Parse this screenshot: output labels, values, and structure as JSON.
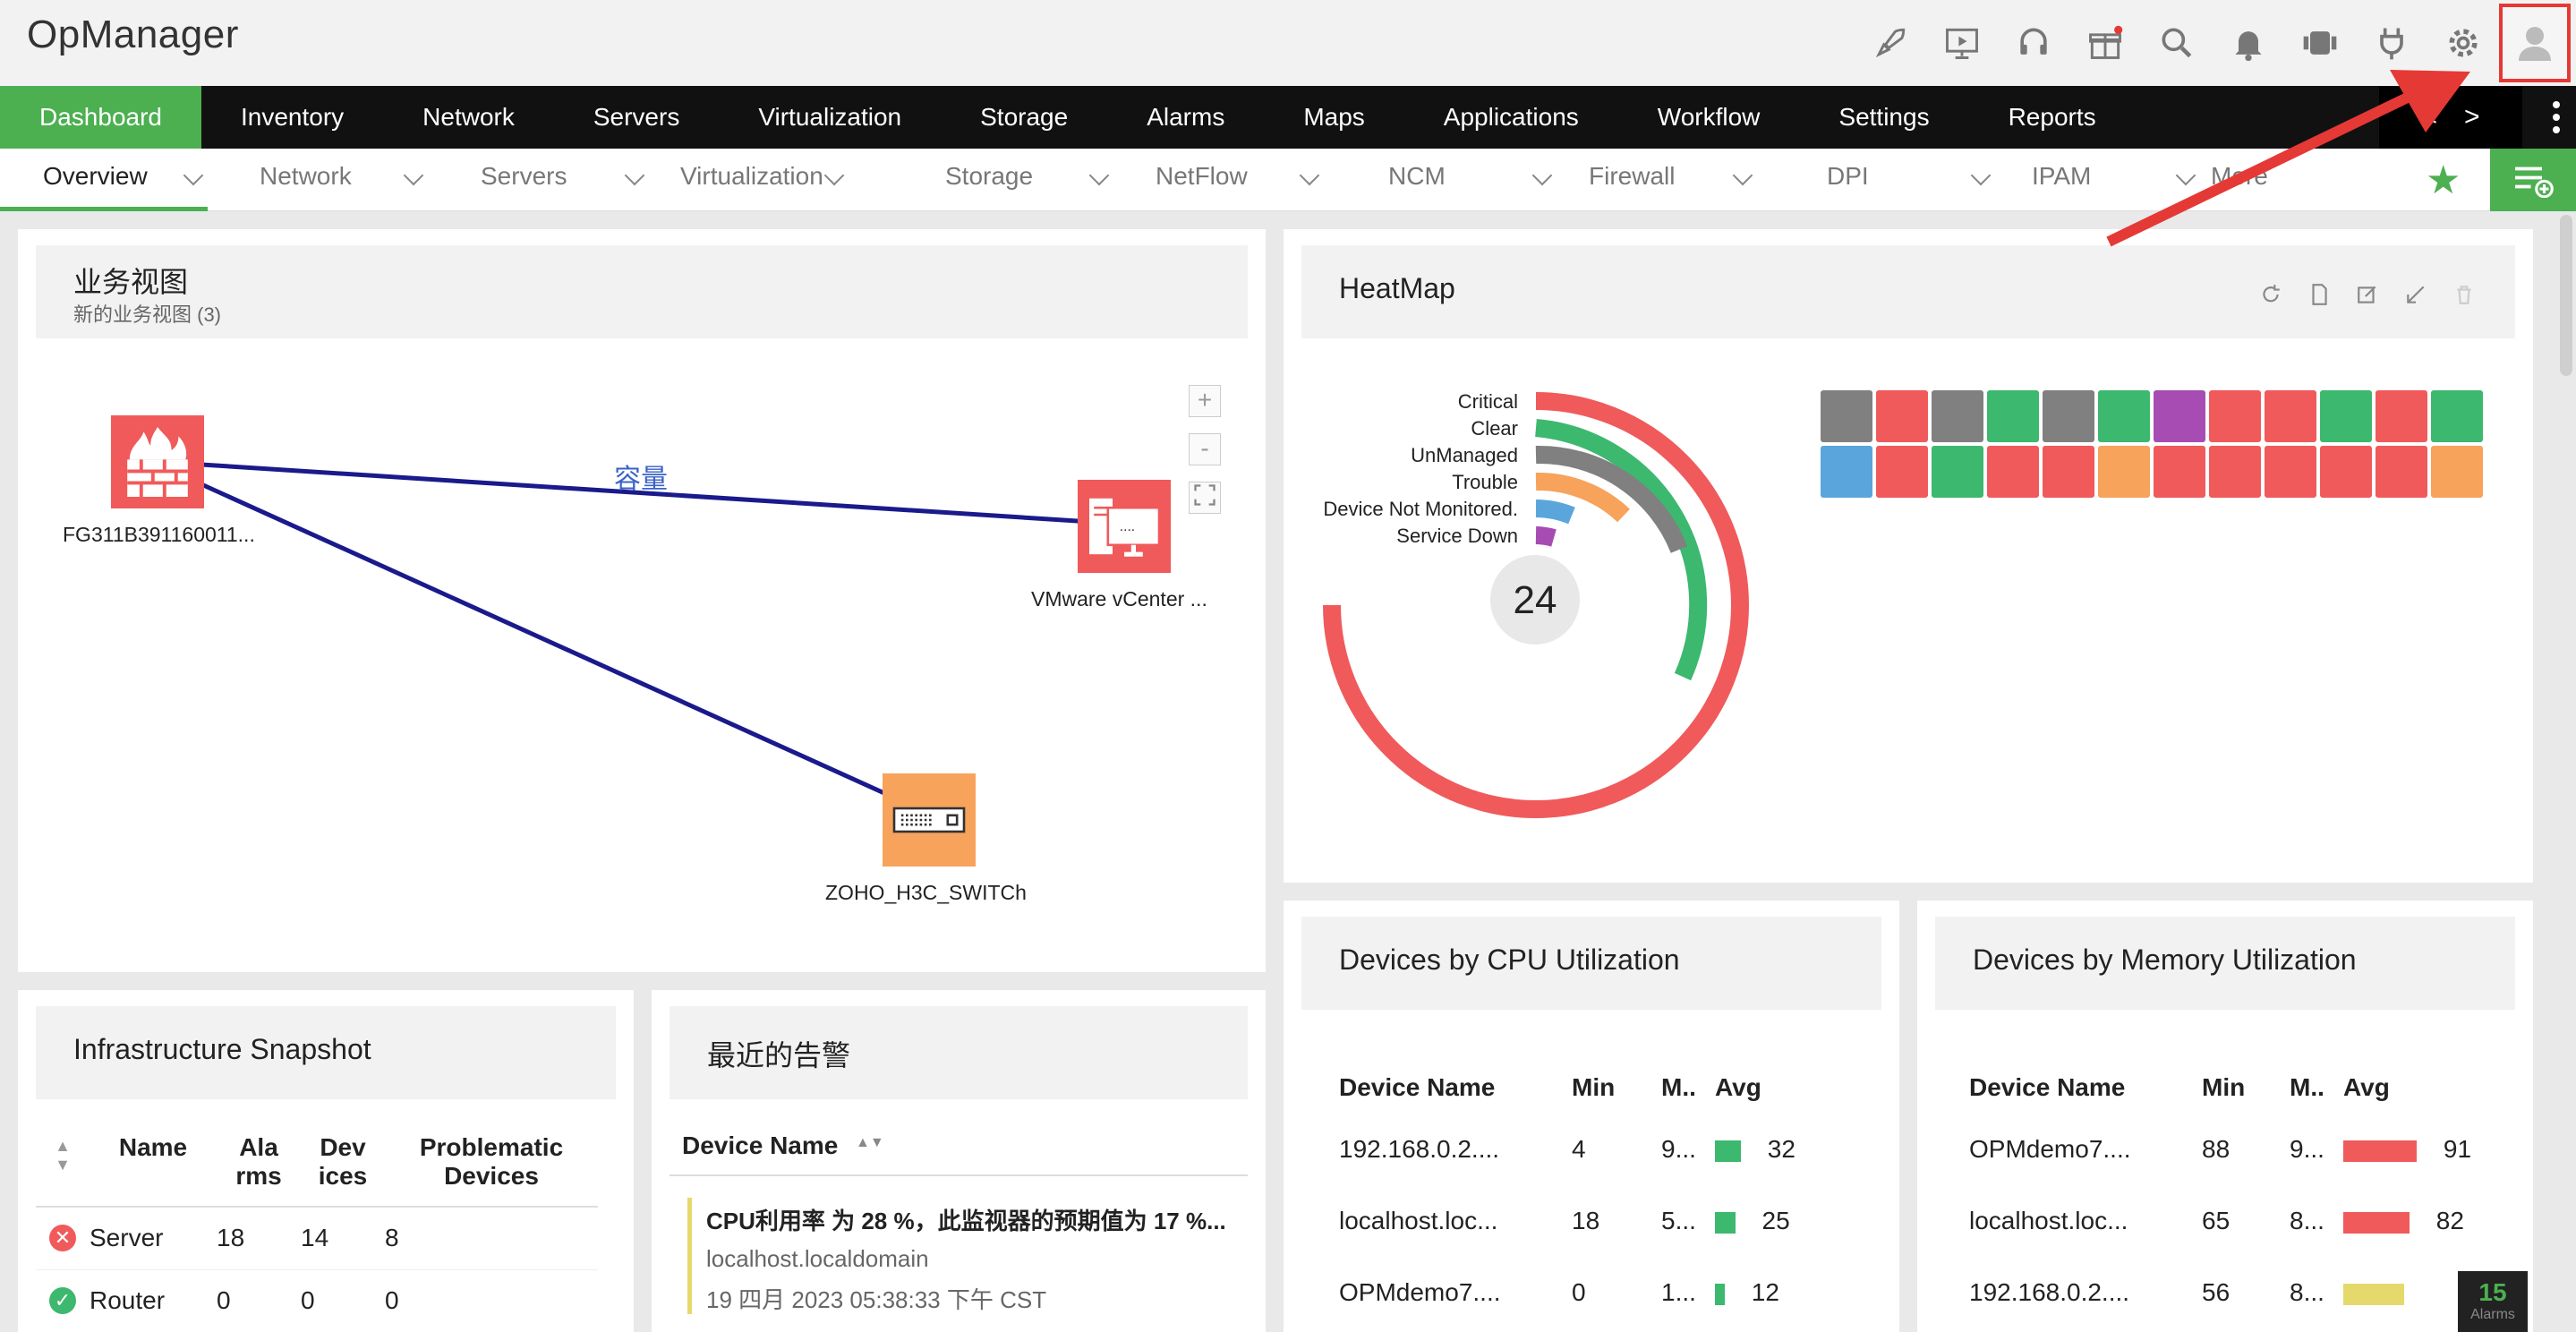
{
  "header": {
    "logo": "OpManager",
    "icons": [
      "rocket-icon",
      "presentation-icon",
      "headset-icon",
      "gift-icon",
      "search-icon",
      "bell-icon",
      "server-icon",
      "plug-icon",
      "gear-icon",
      "user-avatar-icon"
    ]
  },
  "main_nav": [
    "Dashboard",
    "Inventory",
    "Network",
    "Servers",
    "Virtualization",
    "Storage",
    "Alarms",
    "Maps",
    "Applications",
    "Workflow",
    "Settings",
    "Reports"
  ],
  "main_nav_arrows": {
    "left": "<",
    "right": ">"
  },
  "sub_nav": [
    "Overview",
    "Network",
    "Servers",
    "Virtualization",
    "Storage",
    "NetFlow",
    "NCM",
    "Firewall",
    "DPI",
    "IPAM",
    "More"
  ],
  "business_view": {
    "title": "业务视图",
    "subtitle": "新的业务视图 (3)",
    "link_label": "容量",
    "nodes": [
      {
        "label": "FG311B391160011..."
      },
      {
        "label": "VMware vCenter ..."
      },
      {
        "label": "ZOHO_H3C_SWITCh"
      }
    ],
    "zoom": {
      "plus": "+",
      "minus": "-"
    }
  },
  "heatmap": {
    "title": "HeatMap",
    "total": "24",
    "legend": [
      "Critical",
      "Clear",
      "UnManaged",
      "Trouble",
      "Device Not Monitored.",
      "Service Down"
    ],
    "colors": {
      "critical": "#f05a5b",
      "clear": "#3db86f",
      "unmanaged": "#808080",
      "trouble": "#f7a35c",
      "not_monitored": "#5aa6dc",
      "service_down": "#a64cb2"
    },
    "cells": [
      "#808080",
      "#f05a5b",
      "#808080",
      "#3db86f",
      "#808080",
      "#3db86f",
      "#a64cb2",
      "#f05a5b",
      "#f05a5b",
      "#3db86f",
      "#f05a5b",
      "#3db86f",
      "#5aa6dc",
      "#f05a5b",
      "#3db86f",
      "#f05a5b",
      "#f05a5b",
      "#f7a35c",
      "#f05a5b",
      "#f05a5b",
      "#f05a5b",
      "#f05a5b",
      "#f05a5b",
      "#f7a35c"
    ]
  },
  "cpu": {
    "title": "Devices by CPU Utilization",
    "headers": [
      "Device Name",
      "Min",
      "M..",
      "Avg"
    ],
    "rows": [
      {
        "name": "192.168.0.2....",
        "min": "4",
        "max": "9...",
        "avg": "32",
        "fill": 0.32,
        "color": "#3db86f"
      },
      {
        "name": "localhost.loc...",
        "min": "18",
        "max": "5...",
        "avg": "25",
        "fill": 0.25,
        "color": "#3db86f"
      },
      {
        "name": "OPMdemo7....",
        "min": "0",
        "max": "1...",
        "avg": "12",
        "fill": 0.12,
        "color": "#3db86f"
      }
    ]
  },
  "memory": {
    "title": "Devices by Memory Utilization",
    "headers": [
      "Device Name",
      "Min",
      "M..",
      "Avg"
    ],
    "rows": [
      {
        "name": "OPMdemo7....",
        "min": "88",
        "max": "9...",
        "avg": "91",
        "fill": 0.91,
        "color": "#f05a5b"
      },
      {
        "name": "localhost.loc...",
        "min": "65",
        "max": "8...",
        "avg": "82",
        "fill": 0.82,
        "color": "#f05a5b"
      },
      {
        "name": "192.168.0.2....",
        "min": "56",
        "max": "8...",
        "avg": "",
        "fill": 0.76,
        "color": "#e6d96b"
      }
    ]
  },
  "infra": {
    "title": "Infrastructure Snapshot",
    "headers": [
      "Name",
      "Ala rms",
      "Dev ices",
      "Problematic Devices"
    ],
    "rows": [
      {
        "name": "Server",
        "alarms": "18",
        "devices": "14",
        "problem": "8",
        "status": "critical"
      },
      {
        "name": "Router",
        "alarms": "0",
        "devices": "0",
        "problem": "0",
        "status": "clear"
      }
    ]
  },
  "alarms": {
    "title": "最近的告警",
    "header": "Device Name",
    "items": [
      {
        "message": "CPU利用率 为 28 %，此监视器的预期值为 17 %...",
        "device": "localhost.localdomain",
        "time": "19 四月 2023 05:38:33 下午 CST"
      }
    ]
  },
  "alarm_badge": {
    "count": "15",
    "label": "Alarms"
  }
}
